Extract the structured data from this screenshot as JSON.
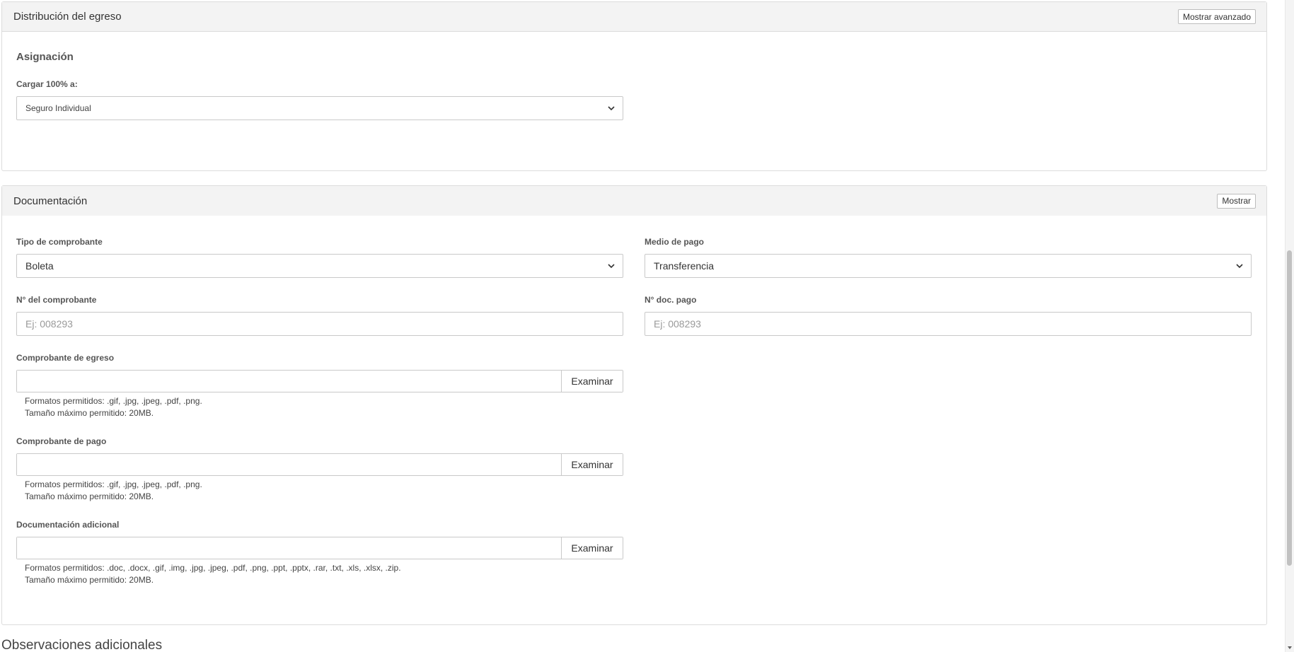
{
  "distribution": {
    "title": "Distribución del egreso",
    "advanced_button": "Mostrar avanzado",
    "section_title": "Asignación",
    "charge_label": "Cargar 100% a:",
    "charge_value": "Seguro Individual"
  },
  "documentation": {
    "title": "Documentación",
    "show_button": "Mostrar",
    "receipt_type": {
      "label": "Tipo de comprobante",
      "value": "Boleta"
    },
    "payment_method": {
      "label": "Medio de pago",
      "value": "Transferencia"
    },
    "receipt_number": {
      "label": "N° del comprobante",
      "placeholder": "Ej: 008293"
    },
    "payment_doc_number": {
      "label": "N° doc. pago",
      "placeholder": "Ej: 008293"
    },
    "expense_receipt": {
      "label": "Comprobante de egreso",
      "button": "Examinar",
      "formats": "Formatos permitidos: .gif, .jpg, .jpeg, .pdf, .png.",
      "max_size": "Tamaño máximo permitido: 20MB."
    },
    "payment_receipt": {
      "label": "Comprobante de pago",
      "button": "Examinar",
      "formats": "Formatos permitidos: .gif, .jpg, .jpeg, .pdf, .png.",
      "max_size": "Tamaño máximo permitido: 20MB."
    },
    "additional_docs": {
      "label": "Documentación adicional",
      "button": "Examinar",
      "formats": "Formatos permitidos: .doc, .docx, .gif, .img, .jpg, .jpeg, .pdf, .png, .ppt, .pptx, .rar, .txt, .xls, .xlsx, .zip.",
      "max_size": "Tamaño máximo permitido: 20MB."
    }
  },
  "observations": {
    "title": "Observaciones adicionales"
  },
  "icons": {
    "select_arrow": "chevron-down-icon"
  },
  "colors": {
    "header_bg": "#f3f3f3",
    "border": "#dcdcdc"
  }
}
